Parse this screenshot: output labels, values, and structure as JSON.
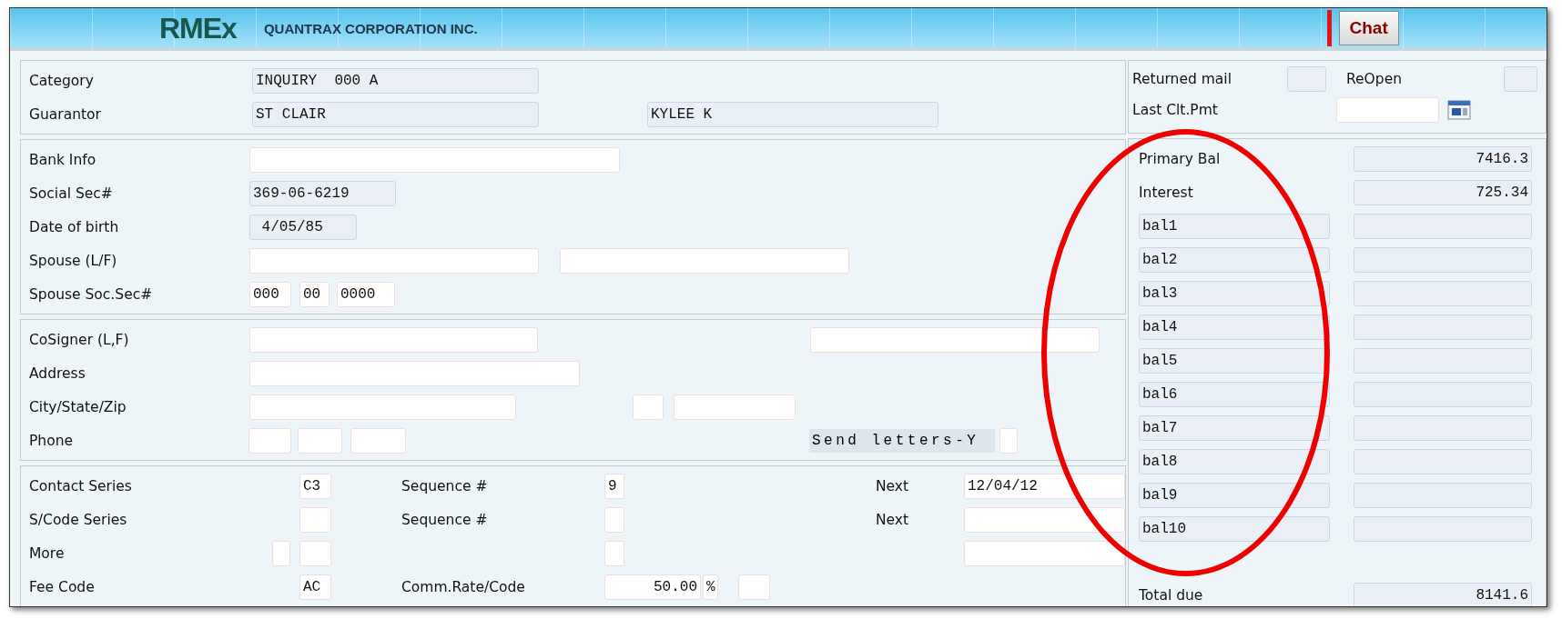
{
  "header": {
    "logo": "RMEx",
    "company": "QUANTRAX CORPORATION INC.",
    "chat_button": "Chat"
  },
  "left_sections": [
    {
      "rows": [
        {
          "items": [
            {
              "kind": "label",
              "text": "Category"
            },
            {
              "kind": "field",
              "readonly": true,
              "value": "INQUIRY  000 A"
            }
          ]
        },
        {
          "items": [
            {
              "kind": "label",
              "text": "Guarantor"
            },
            {
              "kind": "field",
              "readonly": true,
              "value": "ST CLAIR"
            },
            {
              "kind": "field",
              "readonly": true,
              "value": "KYLEE K"
            }
          ]
        }
      ]
    },
    {
      "rows": [
        {
          "items": [
            {
              "kind": "label",
              "text": "Bank Info"
            },
            {
              "kind": "field",
              "readonly": false
            }
          ]
        },
        {
          "items": [
            {
              "kind": "label",
              "text": "Social Sec#"
            },
            {
              "kind": "field",
              "readonly": true,
              "value": "369-06-6219"
            }
          ]
        },
        {
          "items": [
            {
              "kind": "label",
              "text": "Date of birth"
            },
            {
              "kind": "field",
              "readonly": true,
              "value": " 4/05/85"
            }
          ]
        },
        {
          "items": [
            {
              "kind": "label",
              "text": "Spouse (L/F)"
            },
            {
              "kind": "field",
              "readonly": false
            },
            {
              "kind": "field",
              "readonly": false
            }
          ]
        },
        {
          "items": [
            {
              "kind": "label",
              "text": "Spouse Soc.Sec#"
            },
            {
              "kind": "field",
              "readonly": false,
              "value": "000"
            },
            {
              "kind": "field",
              "readonly": false,
              "value": "00"
            },
            {
              "kind": "field",
              "readonly": false,
              "value": "0000"
            }
          ]
        }
      ]
    },
    {
      "rows": [
        {
          "items": [
            {
              "kind": "label",
              "text": "CoSigner (L,F)"
            },
            {
              "kind": "field",
              "readonly": false
            },
            {
              "kind": "field",
              "readonly": false
            }
          ]
        },
        {
          "items": [
            {
              "kind": "label",
              "text": "Address"
            },
            {
              "kind": "field",
              "readonly": false
            }
          ]
        },
        {
          "items": [
            {
              "kind": "label",
              "text": "City/State/Zip"
            },
            {
              "kind": "field",
              "readonly": false
            },
            {
              "kind": "field",
              "readonly": false
            },
            {
              "kind": "field",
              "readonly": false
            }
          ]
        },
        {
          "items": [
            {
              "kind": "label",
              "text": "Phone"
            },
            {
              "kind": "field",
              "readonly": false
            },
            {
              "kind": "field",
              "readonly": false
            },
            {
              "kind": "field",
              "readonly": false
            },
            {
              "kind": "tag",
              "text": "Send letters-Y"
            },
            {
              "kind": "field",
              "readonly": false
            }
          ]
        }
      ]
    },
    {
      "rows": [
        {
          "items": [
            {
              "kind": "label",
              "text": "Contact Series"
            },
            {
              "kind": "field",
              "readonly": false,
              "value": "C3"
            },
            {
              "kind": "label",
              "text": "Sequence #"
            },
            {
              "kind": "field",
              "readonly": false,
              "value": "9"
            },
            {
              "kind": "label",
              "text": "Next"
            },
            {
              "kind": "field",
              "readonly": false,
              "value": "12/04/12"
            }
          ]
        },
        {
          "items": [
            {
              "kind": "label",
              "text": "S/Code Series"
            },
            {
              "kind": "field",
              "readonly": false
            },
            {
              "kind": "label",
              "text": "Sequence #"
            },
            {
              "kind": "field",
              "readonly": false
            },
            {
              "kind": "label",
              "text": "Next"
            },
            {
              "kind": "field",
              "readonly": false
            }
          ]
        },
        {
          "items": [
            {
              "kind": "label",
              "text": "More"
            },
            {
              "kind": "field",
              "readonly": false
            },
            {
              "kind": "field",
              "readonly": false
            },
            {
              "kind": "field",
              "readonly": false
            },
            {
              "kind": "field",
              "readonly": false
            }
          ]
        },
        {
          "items": [
            {
              "kind": "label",
              "text": "Fee Code"
            },
            {
              "kind": "field",
              "readonly": false,
              "value": "AC"
            },
            {
              "kind": "label",
              "text": "Comm.Rate/Code"
            },
            {
              "kind": "field",
              "readonly": false,
              "value": "50.00"
            },
            {
              "kind": "field",
              "readonly": false,
              "value": "%"
            },
            {
              "kind": "field",
              "readonly": false
            }
          ]
        }
      ]
    }
  ],
  "right_sections": [
    {
      "rows": [
        {
          "items": [
            {
              "kind": "label",
              "text": "Returned mail"
            },
            {
              "kind": "field",
              "readonly": true
            },
            {
              "kind": "label",
              "text": "ReOpen"
            },
            {
              "kind": "field",
              "readonly": true
            }
          ]
        },
        {
          "items": [
            {
              "kind": "label",
              "text": "Last Clt.Pmt"
            },
            {
              "kind": "field",
              "readonly": false
            }
          ]
        }
      ]
    },
    {
      "rows": [
        {
          "items": [
            {
              "kind": "label",
              "text": "Primary Bal"
            },
            {
              "kind": "field",
              "readonly": true,
              "value": "7416.3"
            }
          ]
        },
        {
          "items": [
            {
              "kind": "label",
              "text": "Interest"
            },
            {
              "kind": "field",
              "readonly": true,
              "value": "725.34"
            }
          ]
        },
        {
          "items": [
            {
              "kind": "field",
              "readonly": true,
              "value": "bal1"
            },
            {
              "kind": "field",
              "readonly": true
            }
          ]
        },
        {
          "items": [
            {
              "kind": "field",
              "readonly": true,
              "value": "bal2"
            },
            {
              "kind": "field",
              "readonly": true
            }
          ]
        },
        {
          "items": [
            {
              "kind": "field",
              "readonly": true,
              "value": "bal3"
            },
            {
              "kind": "field",
              "readonly": true
            }
          ]
        },
        {
          "items": [
            {
              "kind": "field",
              "readonly": true,
              "value": "bal4"
            },
            {
              "kind": "field",
              "readonly": true
            }
          ]
        },
        {
          "items": [
            {
              "kind": "field",
              "readonly": true,
              "value": "bal5"
            },
            {
              "kind": "field",
              "readonly": true
            }
          ]
        },
        {
          "items": [
            {
              "kind": "field",
              "readonly": true,
              "value": "bal6"
            },
            {
              "kind": "field",
              "readonly": true
            }
          ]
        },
        {
          "items": [
            {
              "kind": "field",
              "readonly": true,
              "value": "bal7"
            },
            {
              "kind": "field",
              "readonly": true
            }
          ]
        },
        {
          "items": [
            {
              "kind": "field",
              "readonly": true,
              "value": "bal8"
            },
            {
              "kind": "field",
              "readonly": true
            }
          ]
        },
        {
          "items": [
            {
              "kind": "field",
              "readonly": true,
              "value": "bal9"
            },
            {
              "kind": "field",
              "readonly": true
            }
          ]
        },
        {
          "items": [
            {
              "kind": "field",
              "readonly": true,
              "value": "bal10"
            },
            {
              "kind": "field",
              "readonly": true
            }
          ]
        },
        {
          "items": [
            {
              "kind": "label",
              "text": "Total due"
            },
            {
              "kind": "field",
              "readonly": true,
              "value": "8141.6"
            }
          ]
        }
      ]
    }
  ]
}
